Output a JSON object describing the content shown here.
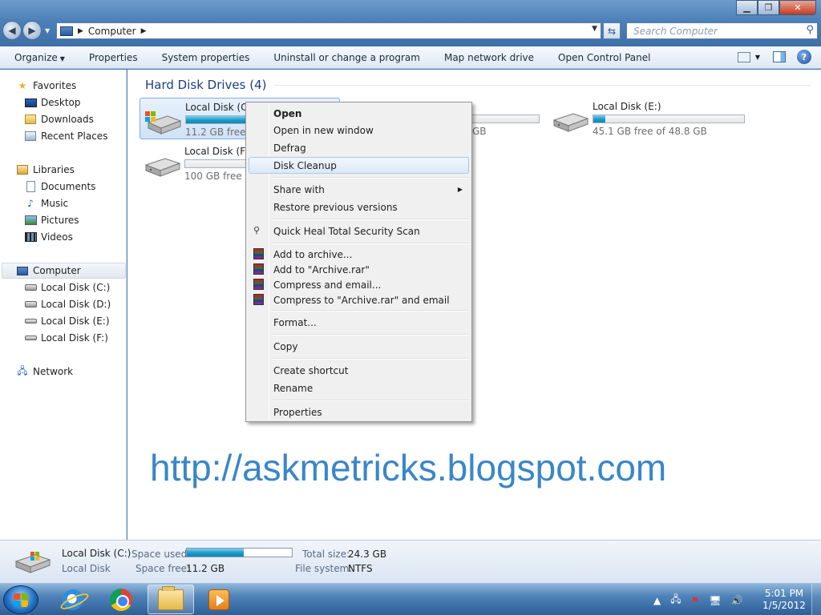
{
  "window": {
    "controls": {
      "minimize": "▁",
      "maximize": "❐",
      "close": "✕"
    }
  },
  "address_bar": {
    "crumb": "Computer",
    "search_placeholder": "Search Computer"
  },
  "command_bar": {
    "items": [
      "Organize",
      "Properties",
      "System properties",
      "Uninstall or change a program",
      "Map network drive",
      "Open Control Panel"
    ]
  },
  "nav_pane": {
    "favorites": "Favorites",
    "favorites_items": [
      "Desktop",
      "Downloads",
      "Recent Places"
    ],
    "libraries": "Libraries",
    "libraries_items": [
      "Documents",
      "Music",
      "Pictures",
      "Videos"
    ],
    "computer": "Computer",
    "computer_items": [
      "Local Disk (C:)",
      "Local Disk (D:)",
      "Local Disk (E:)",
      "Local Disk (F:)"
    ],
    "network": "Network"
  },
  "content": {
    "group_header": "Hard Disk Drives (4)",
    "drives": [
      {
        "name": "Local Disk (C:)",
        "free_text": "11.2 GB free of",
        "used_fraction": 0.54
      },
      {
        "name": "",
        "free_text": "GB",
        "used_fraction": 0.5
      },
      {
        "name": "Local Disk (E:)",
        "free_text": "45.1 GB free of 48.8 GB",
        "used_fraction": 0.08
      },
      {
        "name": "Local Disk (F:)",
        "free_text": "100 GB free of",
        "used_fraction": 0.0
      }
    ]
  },
  "context_menu": {
    "items": [
      {
        "label": "Open",
        "bold": true
      },
      {
        "label": "Open in new window"
      },
      {
        "label": "Defrag"
      },
      {
        "label": "Disk Cleanup",
        "highlighted": true
      },
      {
        "label": "Share with",
        "submenu": true
      },
      {
        "label": "Restore previous versions"
      },
      {
        "label": "Quick Heal Total Security Scan"
      },
      {
        "label": "Add to archive..."
      },
      {
        "label": "Add to \"Archive.rar\""
      },
      {
        "label": "Compress and email..."
      },
      {
        "label": "Compress to \"Archive.rar\" and email"
      },
      {
        "label": "Format..."
      },
      {
        "label": "Copy"
      },
      {
        "label": "Create shortcut"
      },
      {
        "label": "Rename"
      },
      {
        "label": "Properties"
      }
    ]
  },
  "watermark": "http://askmetricks.blogspot.com",
  "details_pane": {
    "name": "Local Disk (C:)",
    "type": "Local Disk",
    "space_used_label": "Space used:",
    "space_used_fraction": 0.54,
    "space_free_label": "Space free:",
    "space_free_value": "11.2 GB",
    "total_size_label": "Total size:",
    "total_size_value": "24.3 GB",
    "file_system_label": "File system:",
    "file_system_value": "NTFS"
  },
  "taskbar": {
    "time": "5:01 PM",
    "date": "1/5/2012"
  }
}
